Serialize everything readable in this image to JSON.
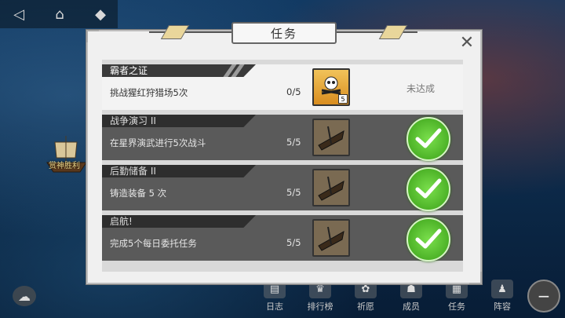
{
  "modal": {
    "title": "任务",
    "close_label": "✕"
  },
  "quests": [
    {
      "name": "霸者之证",
      "desc": "挑战猩红狩猎场5次",
      "progress": "0/5",
      "reward_count": "5",
      "status": "未达成",
      "completed": false
    },
    {
      "name": "战争演习 II",
      "desc": "在星界演武进行5次战斗",
      "progress": "5/5",
      "completed": true
    },
    {
      "name": "后勤储备 II",
      "desc": "铸造装备  5  次",
      "progress": "5/5",
      "completed": true
    },
    {
      "name": "启航!",
      "desc": "完成5个每日委托任务",
      "progress": "5/5",
      "completed": true
    }
  ],
  "bottom_menu": [
    "日志",
    "排行榜",
    "祈愿",
    "成员",
    "任务",
    "阵容"
  ],
  "map": {
    "ship_label": "赏神胜利"
  },
  "icons": [
    "back-icon",
    "home-icon",
    "alert-icon",
    "chat-icon",
    "close-icon",
    "check-icon"
  ],
  "colors": {
    "check_green": "#4bbf22",
    "reward_gold": "#e5a43a",
    "panel_bg": "#f0f0f0"
  }
}
